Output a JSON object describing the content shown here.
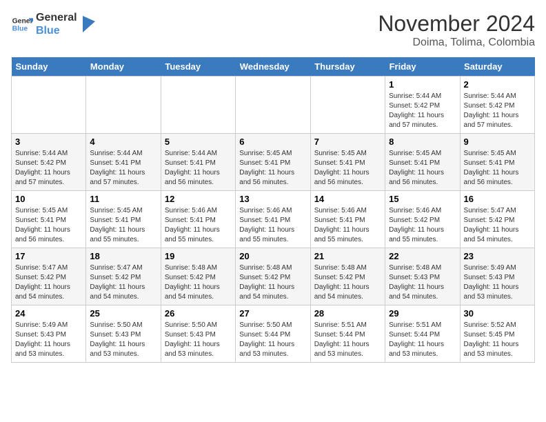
{
  "header": {
    "logo_line1": "General",
    "logo_line2": "Blue",
    "month": "November 2024",
    "location": "Doima, Tolima, Colombia"
  },
  "days_of_week": [
    "Sunday",
    "Monday",
    "Tuesday",
    "Wednesday",
    "Thursday",
    "Friday",
    "Saturday"
  ],
  "weeks": [
    [
      {
        "day": "",
        "info": ""
      },
      {
        "day": "",
        "info": ""
      },
      {
        "day": "",
        "info": ""
      },
      {
        "day": "",
        "info": ""
      },
      {
        "day": "",
        "info": ""
      },
      {
        "day": "1",
        "info": "Sunrise: 5:44 AM\nSunset: 5:42 PM\nDaylight: 11 hours\nand 57 minutes."
      },
      {
        "day": "2",
        "info": "Sunrise: 5:44 AM\nSunset: 5:42 PM\nDaylight: 11 hours\nand 57 minutes."
      }
    ],
    [
      {
        "day": "3",
        "info": "Sunrise: 5:44 AM\nSunset: 5:42 PM\nDaylight: 11 hours\nand 57 minutes."
      },
      {
        "day": "4",
        "info": "Sunrise: 5:44 AM\nSunset: 5:41 PM\nDaylight: 11 hours\nand 57 minutes."
      },
      {
        "day": "5",
        "info": "Sunrise: 5:44 AM\nSunset: 5:41 PM\nDaylight: 11 hours\nand 56 minutes."
      },
      {
        "day": "6",
        "info": "Sunrise: 5:45 AM\nSunset: 5:41 PM\nDaylight: 11 hours\nand 56 minutes."
      },
      {
        "day": "7",
        "info": "Sunrise: 5:45 AM\nSunset: 5:41 PM\nDaylight: 11 hours\nand 56 minutes."
      },
      {
        "day": "8",
        "info": "Sunrise: 5:45 AM\nSunset: 5:41 PM\nDaylight: 11 hours\nand 56 minutes."
      },
      {
        "day": "9",
        "info": "Sunrise: 5:45 AM\nSunset: 5:41 PM\nDaylight: 11 hours\nand 56 minutes."
      }
    ],
    [
      {
        "day": "10",
        "info": "Sunrise: 5:45 AM\nSunset: 5:41 PM\nDaylight: 11 hours\nand 56 minutes."
      },
      {
        "day": "11",
        "info": "Sunrise: 5:45 AM\nSunset: 5:41 PM\nDaylight: 11 hours\nand 55 minutes."
      },
      {
        "day": "12",
        "info": "Sunrise: 5:46 AM\nSunset: 5:41 PM\nDaylight: 11 hours\nand 55 minutes."
      },
      {
        "day": "13",
        "info": "Sunrise: 5:46 AM\nSunset: 5:41 PM\nDaylight: 11 hours\nand 55 minutes."
      },
      {
        "day": "14",
        "info": "Sunrise: 5:46 AM\nSunset: 5:41 PM\nDaylight: 11 hours\nand 55 minutes."
      },
      {
        "day": "15",
        "info": "Sunrise: 5:46 AM\nSunset: 5:42 PM\nDaylight: 11 hours\nand 55 minutes."
      },
      {
        "day": "16",
        "info": "Sunrise: 5:47 AM\nSunset: 5:42 PM\nDaylight: 11 hours\nand 54 minutes."
      }
    ],
    [
      {
        "day": "17",
        "info": "Sunrise: 5:47 AM\nSunset: 5:42 PM\nDaylight: 11 hours\nand 54 minutes."
      },
      {
        "day": "18",
        "info": "Sunrise: 5:47 AM\nSunset: 5:42 PM\nDaylight: 11 hours\nand 54 minutes."
      },
      {
        "day": "19",
        "info": "Sunrise: 5:48 AM\nSunset: 5:42 PM\nDaylight: 11 hours\nand 54 minutes."
      },
      {
        "day": "20",
        "info": "Sunrise: 5:48 AM\nSunset: 5:42 PM\nDaylight: 11 hours\nand 54 minutes."
      },
      {
        "day": "21",
        "info": "Sunrise: 5:48 AM\nSunset: 5:42 PM\nDaylight: 11 hours\nand 54 minutes."
      },
      {
        "day": "22",
        "info": "Sunrise: 5:48 AM\nSunset: 5:43 PM\nDaylight: 11 hours\nand 54 minutes."
      },
      {
        "day": "23",
        "info": "Sunrise: 5:49 AM\nSunset: 5:43 PM\nDaylight: 11 hours\nand 53 minutes."
      }
    ],
    [
      {
        "day": "24",
        "info": "Sunrise: 5:49 AM\nSunset: 5:43 PM\nDaylight: 11 hours\nand 53 minutes."
      },
      {
        "day": "25",
        "info": "Sunrise: 5:50 AM\nSunset: 5:43 PM\nDaylight: 11 hours\nand 53 minutes."
      },
      {
        "day": "26",
        "info": "Sunrise: 5:50 AM\nSunset: 5:43 PM\nDaylight: 11 hours\nand 53 minutes."
      },
      {
        "day": "27",
        "info": "Sunrise: 5:50 AM\nSunset: 5:44 PM\nDaylight: 11 hours\nand 53 minutes."
      },
      {
        "day": "28",
        "info": "Sunrise: 5:51 AM\nSunset: 5:44 PM\nDaylight: 11 hours\nand 53 minutes."
      },
      {
        "day": "29",
        "info": "Sunrise: 5:51 AM\nSunset: 5:44 PM\nDaylight: 11 hours\nand 53 minutes."
      },
      {
        "day": "30",
        "info": "Sunrise: 5:52 AM\nSunset: 5:45 PM\nDaylight: 11 hours\nand 53 minutes."
      }
    ]
  ]
}
